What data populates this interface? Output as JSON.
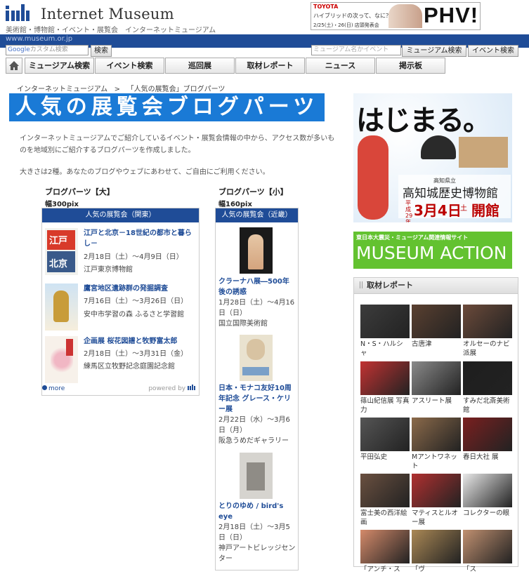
{
  "header": {
    "logo_text": "Internet Museum",
    "tagline": "美術館・博物館・イベント・展覧会　インターネットミュージアム",
    "url": "www.museum.or.jp",
    "google_placeholder": "カスタム検索",
    "google_brand": "Google",
    "site_search_label": "検索",
    "museum_search_placeholder": "ミュージアム名かイベント",
    "museum_search_button": "ミュージアム検索",
    "event_search_button": "イベント検索"
  },
  "ad": {
    "brand": "TOYOTA",
    "copy": "ハイブリッドの次って、なに？",
    "date": "2/25(土)・26(日) 店頭発表会",
    "headline": "PHV!"
  },
  "nav": {
    "items": [
      "ミュージアム検索",
      "イベント検索",
      "巡回展",
      "取材レポート",
      "ニュース",
      "掲示板"
    ]
  },
  "breadcrumb": {
    "home": "インターネットミュージアム",
    "sep": ">",
    "current": "「人気の展覧会」ブログパーツ"
  },
  "page": {
    "title": "人気の展覧会ブログパーツ",
    "intro1": "インターネットミュージアムでご紹介しているイベント・展覧会情報の中から、アクセス数が多いものを地域別にご紹介するブログパーツを作成しました。",
    "intro2": "大きさは2種。あなたのブログやウェブにあわせて、ご自由にご利用ください。"
  },
  "large": {
    "heading": "ブログパーツ【大】",
    "width": "幅300pix",
    "widget_title": "人気の展覧会（関東）",
    "items": [
      {
        "title": "江戸と北京－18世紀の都市と暮らし－",
        "date": "2月18日（土）～4月9日（日）",
        "venue": "江戸東京博物館"
      },
      {
        "title": "鷹宮地区遺跡群の発掘調査",
        "date": "7月16日（土）～3月26日（日）",
        "venue": "安中市学習の森 ふるさと学習館"
      },
      {
        "title": "企画展 桜花図譜と牧野富太郎",
        "date": "2月18日（土）～3月31日（金）",
        "venue": "練馬区立牧野記念庭園記念館"
      }
    ],
    "more": "more",
    "powered": "powered by"
  },
  "small": {
    "heading": "ブログパーツ【小】",
    "width": "幅160pix",
    "widget_title": "人気の展覧会（近畿）",
    "items": [
      {
        "title": "クラーナハ展―500年後の誘惑",
        "date": "1月28日（土）～4月16日（日）",
        "venue": "国立国際美術館"
      },
      {
        "title": "日本・モナコ友好10周年記念 グレース・ケリー展",
        "date": "2月22日（水）～3月6日（月）",
        "venue": "阪急うめだギャラリー"
      },
      {
        "title": "とりのゆめ / bird's eye",
        "date": "2月18日（土）～3月5日（日）",
        "venue": "神戸アートビレッジセンター"
      }
    ]
  },
  "sidebar": {
    "banner1": {
      "headline": "はじまる。",
      "org": "高知県立",
      "name": "高知城歴史博物館",
      "era": "平成29年",
      "date": "3月4日",
      "day": "土",
      "open": "開館"
    },
    "banner2": {
      "sub": "東日本大震災・ミュージアム関連情報サイト",
      "title": "MUSEUM ACTION"
    },
    "report": {
      "heading": "取材レポート",
      "items": [
        {
          "label": "N・S・ハルシャ",
          "color": "#3c3c3c"
        },
        {
          "label": "古唐津",
          "color": "#5a4030"
        },
        {
          "label": "オルセーのナビ派展",
          "color": "#6b4a3a"
        },
        {
          "label": "篠山紀信展 写真力",
          "color": "#c23232"
        },
        {
          "label": "アスリート展",
          "color": "#8a8a8a"
        },
        {
          "label": "すみだ北斎美術館",
          "color": "#1e1e1e"
        },
        {
          "label": "平田弘史",
          "color": "#555555"
        },
        {
          "label": "Mアントワネット",
          "color": "#8b6a4a"
        },
        {
          "label": "春日大社 展",
          "color": "#7a2020"
        },
        {
          "label": "富士美の西洋絵画",
          "color": "#6a5040"
        },
        {
          "label": "マティスとルオー展",
          "color": "#b03030"
        },
        {
          "label": "コレクターの眼",
          "color": "#e8e8e8"
        },
        {
          "label": "「アンチ・ス",
          "color": "#d48a6a"
        },
        {
          "label": "「ヴ",
          "color": "#aa8855"
        },
        {
          "label": "「ス",
          "color": "#c09070"
        }
      ]
    }
  }
}
